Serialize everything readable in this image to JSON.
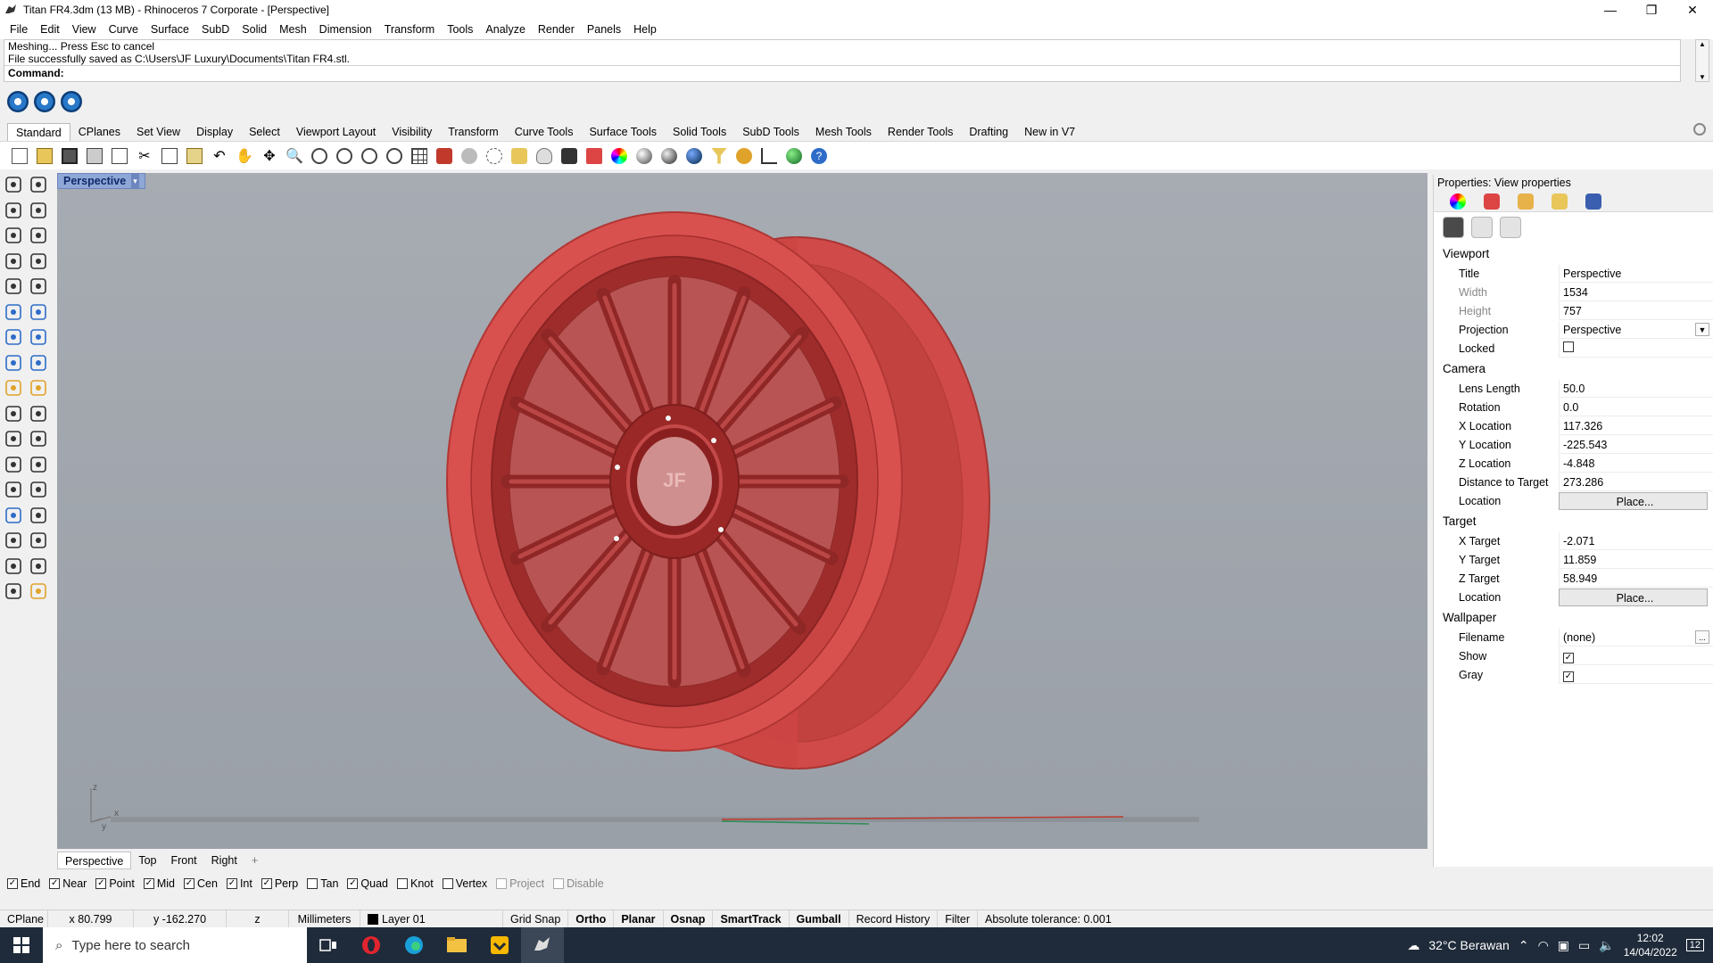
{
  "window": {
    "title": "Titan FR4.3dm (13 MB) - Rhinoceros 7 Corporate - [Perspective]",
    "minimize": "—",
    "maximize": "❐",
    "close": "✕"
  },
  "menu": [
    "File",
    "Edit",
    "View",
    "Curve",
    "Surface",
    "SubD",
    "Solid",
    "Mesh",
    "Dimension",
    "Transform",
    "Tools",
    "Analyze",
    "Render",
    "Panels",
    "Help"
  ],
  "command_history": {
    "line1": "Meshing... Press Esc to cancel",
    "line2": "File successfully saved as C:\\Users\\JF Luxury\\Documents\\Titan FR4.stl.",
    "prompt": "Command:"
  },
  "toolbar_tabs": [
    "Standard",
    "CPlanes",
    "Set View",
    "Display",
    "Select",
    "Viewport Layout",
    "Visibility",
    "Transform",
    "Curve Tools",
    "Surface Tools",
    "Solid Tools",
    "SubD Tools",
    "Mesh Tools",
    "Render Tools",
    "Drafting",
    "New in V7"
  ],
  "viewport": {
    "label": "Perspective",
    "caret": "▾",
    "axis_z": "z",
    "axis_x": "x",
    "axis_y": "y",
    "hub_logo": "JF"
  },
  "view_tabs": [
    "Perspective",
    "Top",
    "Front",
    "Right",
    "+"
  ],
  "osnaps": [
    {
      "label": "End",
      "checked": "✓"
    },
    {
      "label": "Near",
      "checked": "✓"
    },
    {
      "label": "Point",
      "checked": "✓"
    },
    {
      "label": "Mid",
      "checked": "✓"
    },
    {
      "label": "Cen",
      "checked": "✓"
    },
    {
      "label": "Int",
      "checked": "✓"
    },
    {
      "label": "Perp",
      "checked": "✓"
    },
    {
      "label": "Tan",
      "checked": ""
    },
    {
      "label": "Quad",
      "checked": "✓"
    },
    {
      "label": "Knot",
      "checked": ""
    },
    {
      "label": "Vertex",
      "checked": ""
    },
    {
      "label": "Project",
      "checked": ""
    },
    {
      "label": "Disable",
      "checked": ""
    }
  ],
  "status": {
    "cplane": "CPlane",
    "x": "x 80.799",
    "y": "y -162.270",
    "z": "z",
    "units": "Millimeters",
    "layer": "Layer 01",
    "grid_snap": "Grid Snap",
    "ortho": "Ortho",
    "planar": "Planar",
    "osnap": "Osnap",
    "smarttrack": "SmartTrack",
    "gumball": "Gumball",
    "record_history": "Record History",
    "filter": "Filter",
    "tolerance": "Absolute tolerance: 0.001"
  },
  "properties": {
    "title": "Properties: View properties",
    "viewport_section": "Viewport",
    "title_label": "Title",
    "title_value": "Perspective",
    "width_label": "Width",
    "width_value": "1534",
    "height_label": "Height",
    "height_value": "757",
    "projection_label": "Projection",
    "projection_value": "Perspective",
    "locked_label": "Locked",
    "locked_value": "",
    "camera_section": "Camera",
    "lens_label": "Lens Length",
    "lens_value": "50.0",
    "rotation_label": "Rotation",
    "rotation_value": "0.0",
    "xloc_label": "X Location",
    "xloc_value": "117.326",
    "yloc_label": "Y Location",
    "yloc_value": "-225.543",
    "zloc_label": "Z Location",
    "zloc_value": "-4.848",
    "dist_label": "Distance to Target",
    "dist_value": "273.286",
    "location_label": "Location",
    "place_label": "Place...",
    "target_section": "Target",
    "xt_label": "X Target",
    "xt_value": "-2.071",
    "yt_label": "Y Target",
    "yt_value": "11.859",
    "zt_label": "Z Target",
    "zt_value": "58.949",
    "target_location_label": "Location",
    "target_place_label": "Place...",
    "wallpaper_section": "Wallpaper",
    "filename_label": "Filename",
    "filename_value": "(none)",
    "filename_browse": "...",
    "show_label": "Show",
    "show_value": "✓",
    "gray_label": "Gray",
    "gray_value": "✓"
  },
  "taskbar": {
    "search_placeholder": "Type here to search",
    "weather": "32°C  Berawan",
    "time": "12:02",
    "date": "14/04/2022",
    "notifications": "12"
  },
  "colors": {
    "wheel_red": "#d9534f",
    "viewport_bg": "#a0a5ac",
    "taskbar": "#1f2b3a"
  }
}
